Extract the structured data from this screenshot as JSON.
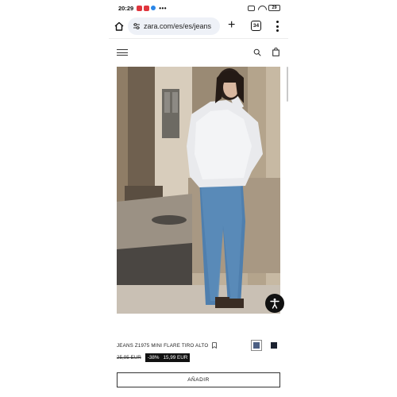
{
  "status_bar": {
    "time": "20:29",
    "more": "•••",
    "battery": "29"
  },
  "browser": {
    "url": "zara.com/es/es/jeans",
    "tab_count": "34",
    "new_tab": "+"
  },
  "icons": {
    "home": "home-icon",
    "site_settings": "tune-icon",
    "menu": "kebab-menu-icon",
    "hamburger": "hamburger-icon",
    "search": "search-icon",
    "bag": "shopping-bag-icon",
    "bookmark": "bookmark-icon",
    "accessibility": "accessibility-icon"
  },
  "product": {
    "title": "JEANS Z1975 MINI FLARE TIRO ALTO",
    "old_price": "25,95 EUR",
    "discount": "-38%",
    "new_price": "15,99 EUR",
    "add_label": "AÑADIR",
    "swatches": [
      {
        "color": "#4c5f83",
        "selected": true
      },
      {
        "color": "#1c2230",
        "selected": false
      }
    ]
  }
}
